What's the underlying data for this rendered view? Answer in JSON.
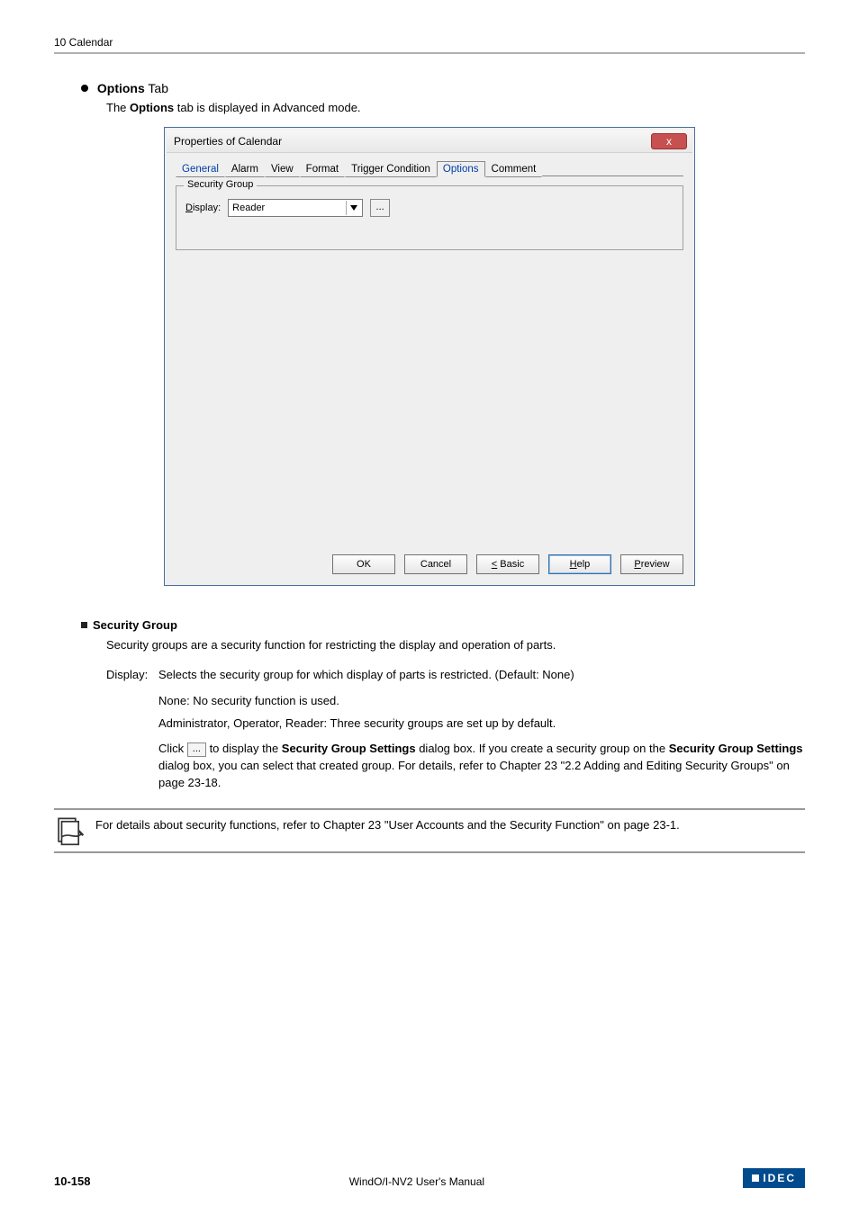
{
  "header": {
    "title": "10 Calendar"
  },
  "section": {
    "bullet_title_b": "Options",
    "bullet_title_tail": " Tab",
    "intro_pre": "The ",
    "intro_bold": "Options",
    "intro_post": " tab is displayed in Advanced mode."
  },
  "dialog": {
    "title": "Properties of Calendar",
    "close": "x",
    "tabs": {
      "general": "General",
      "alarm": "Alarm",
      "view": "View",
      "format": "Format",
      "trigger": "Trigger Condition",
      "options": "Options",
      "comment": "Comment"
    },
    "group": {
      "legend": "Security Group",
      "display_label_u": "D",
      "display_label_rest": "isplay:",
      "display_value": "Reader",
      "dots": "..."
    },
    "buttons": {
      "ok": "OK",
      "cancel": "Cancel",
      "basic_u": "<",
      "basic_rest": " Basic",
      "help_u": "H",
      "help_rest": "elp",
      "preview_u": "P",
      "preview_rest": "review"
    }
  },
  "body": {
    "subhead": "Security Group",
    "sub_desc": "Security groups are a security function for restricting the display and operation of parts.",
    "display_label": "Display:",
    "display_desc": "Selects the security group for which display of parts is restricted. (Default: None)",
    "none_line": "None: No security function is used.",
    "admin_line": "Administrator, Operator, Reader: Three security groups are set up by default.",
    "click_pre": "Click ",
    "click_btn": "...",
    "click_mid": " to display the ",
    "click_bold1": "Security Group Settings",
    "click_mid2": " dialog box. If you create a security group on the ",
    "click_bold2": "Security Group Settings",
    "click_post": " dialog box, you can select that created group. For details, refer to Chapter 23 \"2.2 Adding and Editing Security Groups\" on page 23-18.",
    "note": "For details about security functions, refer to Chapter 23 \"User Accounts and the Security Function\" on page 23-1."
  },
  "footer": {
    "page": "10-158",
    "center": "WindO/I-NV2 User's Manual",
    "brand": "IDEC"
  }
}
